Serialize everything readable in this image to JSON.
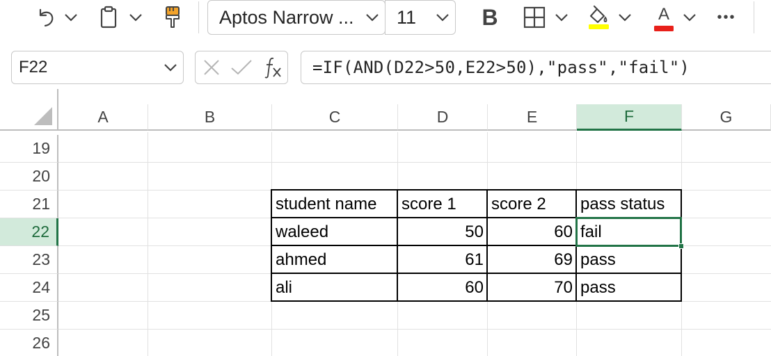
{
  "ribbon": {
    "font_name": "Aptos Narrow ...",
    "font_size": "11",
    "bold_label": "B",
    "fill_color": "#ffff00",
    "font_color": "#e8201a",
    "font_color_letter": "A",
    "more_label": "•••"
  },
  "formula_bar": {
    "name_box": "F22",
    "formula": "=IF(AND(D22>50,E22>50),\"pass\",\"fail\")"
  },
  "columns": [
    "A",
    "B",
    "C",
    "D",
    "E",
    "F",
    "G"
  ],
  "selected_column": "F",
  "rows": [
    "19",
    "20",
    "21",
    "22",
    "23",
    "24",
    "25",
    "26"
  ],
  "selected_row": "22",
  "table": {
    "headers": [
      "student name",
      "score 1",
      "score 2",
      "pass status"
    ],
    "rows": [
      [
        "waleed",
        "50",
        "60",
        "fail"
      ],
      [
        "ahmed",
        "61",
        "69",
        "pass"
      ],
      [
        "ali",
        "60",
        "70",
        "pass"
      ]
    ]
  },
  "colors": {
    "accent": "#217346",
    "selection_header_bg": "#d2eadb"
  }
}
